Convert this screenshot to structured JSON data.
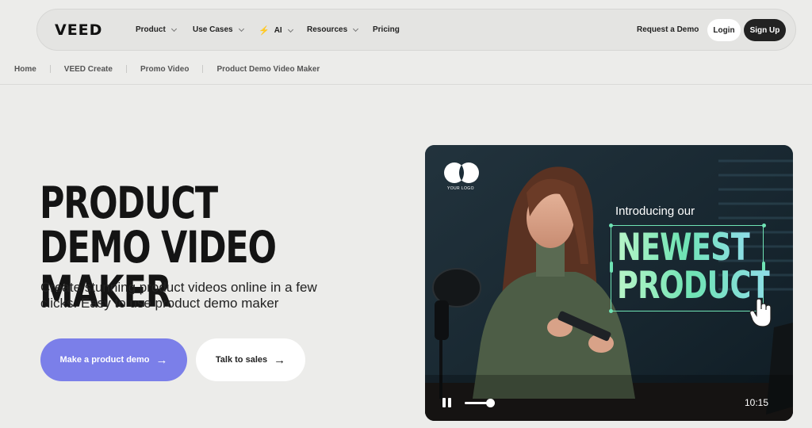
{
  "nav": {
    "logo": "VEED",
    "items": [
      {
        "label": "Product",
        "dropdown": true
      },
      {
        "label": "Use Cases",
        "dropdown": true
      },
      {
        "label": "AI",
        "dropdown": true,
        "icon": "lightning-icon"
      },
      {
        "label": "Resources",
        "dropdown": true
      },
      {
        "label": "Pricing",
        "dropdown": false
      }
    ],
    "request_demo": "Request a Demo",
    "login": "Login",
    "signup": "Sign Up"
  },
  "breadcrumb": [
    "Home",
    "VEED Create",
    "Promo Video",
    "Product Demo Video Maker"
  ],
  "hero": {
    "title": "PRODUCT DEMO VIDEO MAKER",
    "subtitle": "Create stunning product videos online in a few clicks. Easy to use product demo maker",
    "primary_cta": "Make a product demo",
    "secondary_cta": "Talk to sales"
  },
  "video": {
    "logo_text": "YOUR LOGO",
    "intro": "Introducing our",
    "headline_1": "NEWEST",
    "headline_2": "PRODUCT",
    "time": "10:15",
    "progress": 0.1
  },
  "colors": {
    "accent": "#7b7fe9",
    "highlight": "#6fe3b4",
    "dark": "#222222"
  }
}
